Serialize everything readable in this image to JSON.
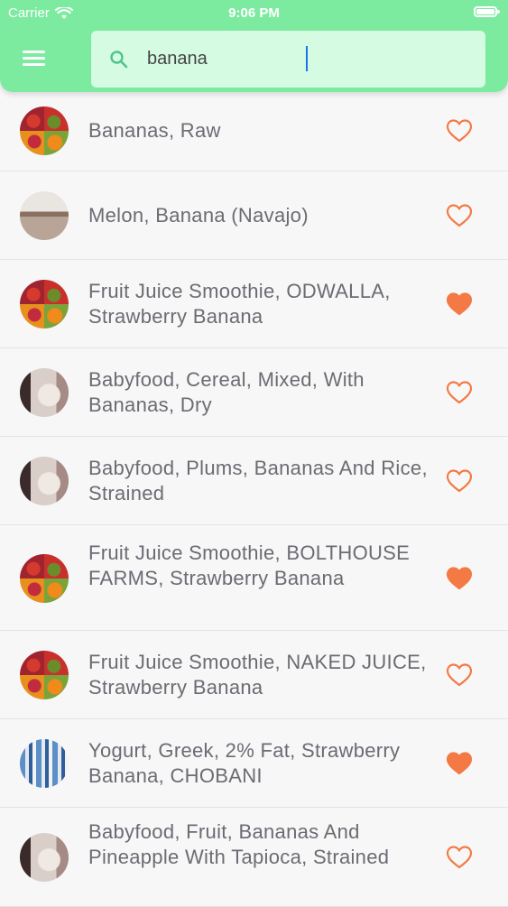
{
  "status_bar": {
    "carrier": "Carrier",
    "time": "9:06 PM"
  },
  "search": {
    "value": "banana"
  },
  "colors": {
    "header": "#7ceba0",
    "search_bg": "#d5fbe2",
    "heart": "#f37a45",
    "text": "#6b6b72"
  },
  "results": [
    {
      "name": "Bananas, Raw",
      "thumb": "fruit",
      "favorite": false
    },
    {
      "name": "Melon, Banana (Navajo)",
      "thumb": "landscape",
      "favorite": false
    },
    {
      "name": "Fruit Juice Smoothie, ODWALLA, Strawberry Banana",
      "thumb": "fruit",
      "favorite": true
    },
    {
      "name": "Babyfood, Cereal, Mixed, With Bananas, Dry",
      "thumb": "baby",
      "favorite": false
    },
    {
      "name": "Babyfood, Plums, Bananas And Rice, Strained",
      "thumb": "baby",
      "favorite": false
    },
    {
      "name": "Fruit Juice Smoothie, BOLTHOUSE FARMS, Strawberry Banana",
      "thumb": "fruit",
      "favorite": true
    },
    {
      "name": "Fruit Juice Smoothie, NAKED JUICE, Strawberry Banana",
      "thumb": "fruit",
      "favorite": false
    },
    {
      "name": "Yogurt, Greek, 2% Fat, Strawberry Banana, CHOBANI",
      "thumb": "yogurt",
      "favorite": true
    },
    {
      "name": "Babyfood, Fruit, Bananas And Pineapple With Tapioca, Strained",
      "thumb": "baby",
      "favorite": false
    }
  ]
}
